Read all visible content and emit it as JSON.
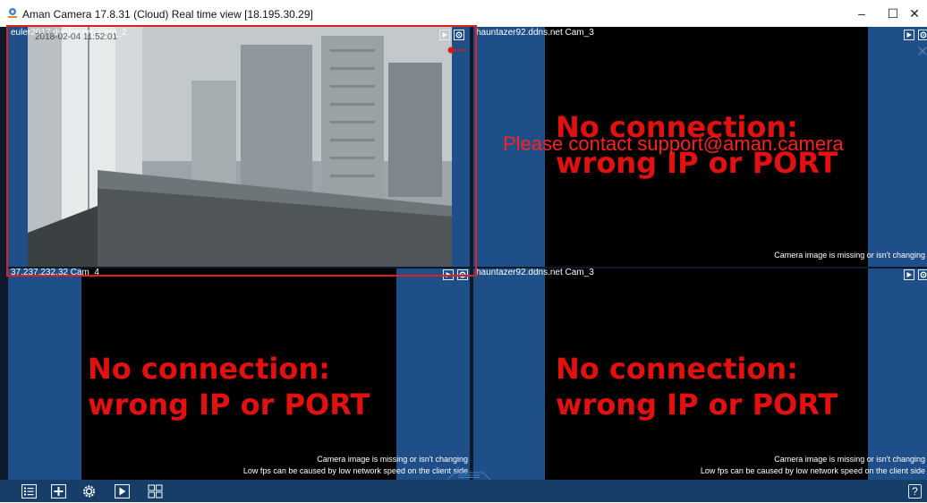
{
  "window": {
    "title": "Aman Camera 17.8.31 (Cloud) Real time view [18.195.30.29]",
    "minimize": "–",
    "maximize": "☐",
    "close": "✕"
  },
  "panes": [
    {
      "label": "euler2017.dvrdns.org Cam_2",
      "timestamp": "2018-02-04  11:52:01",
      "status": "live"
    },
    {
      "label": "hauntazer92.ddns.net Cam_3",
      "no_connection_line1": "No connection:",
      "no_connection_line2": "wrong IP or PORT",
      "support_text": "Please contact support@aman.camera",
      "message1": "Camera image is missing or isn't changing"
    },
    {
      "label": "37.237.232.32 Cam_4",
      "no_connection_line1": "No connection:",
      "no_connection_line2": "wrong IP or PORT",
      "message1": "Camera image is missing or isn't changing",
      "message2": "Low fps can be caused by low network speed on the client side"
    },
    {
      "label": "hauntazer92.ddns.net Cam_3",
      "no_connection_line1": "No connection:",
      "no_connection_line2": "wrong IP or PORT",
      "message1": "Camera image is missing or isn't changing",
      "message2": "Low fps can be caused by low network speed on the client side"
    }
  ],
  "toolbar": {
    "buttons": [
      "list-icon",
      "add-icon",
      "settings-icon",
      "play-icon",
      "grid-icon"
    ],
    "help_label": "?"
  },
  "colors": {
    "pane_background": "#1e4f88",
    "error_text": "#e31010",
    "selection_frame": "#e02020",
    "toolbar": "#163e68"
  }
}
